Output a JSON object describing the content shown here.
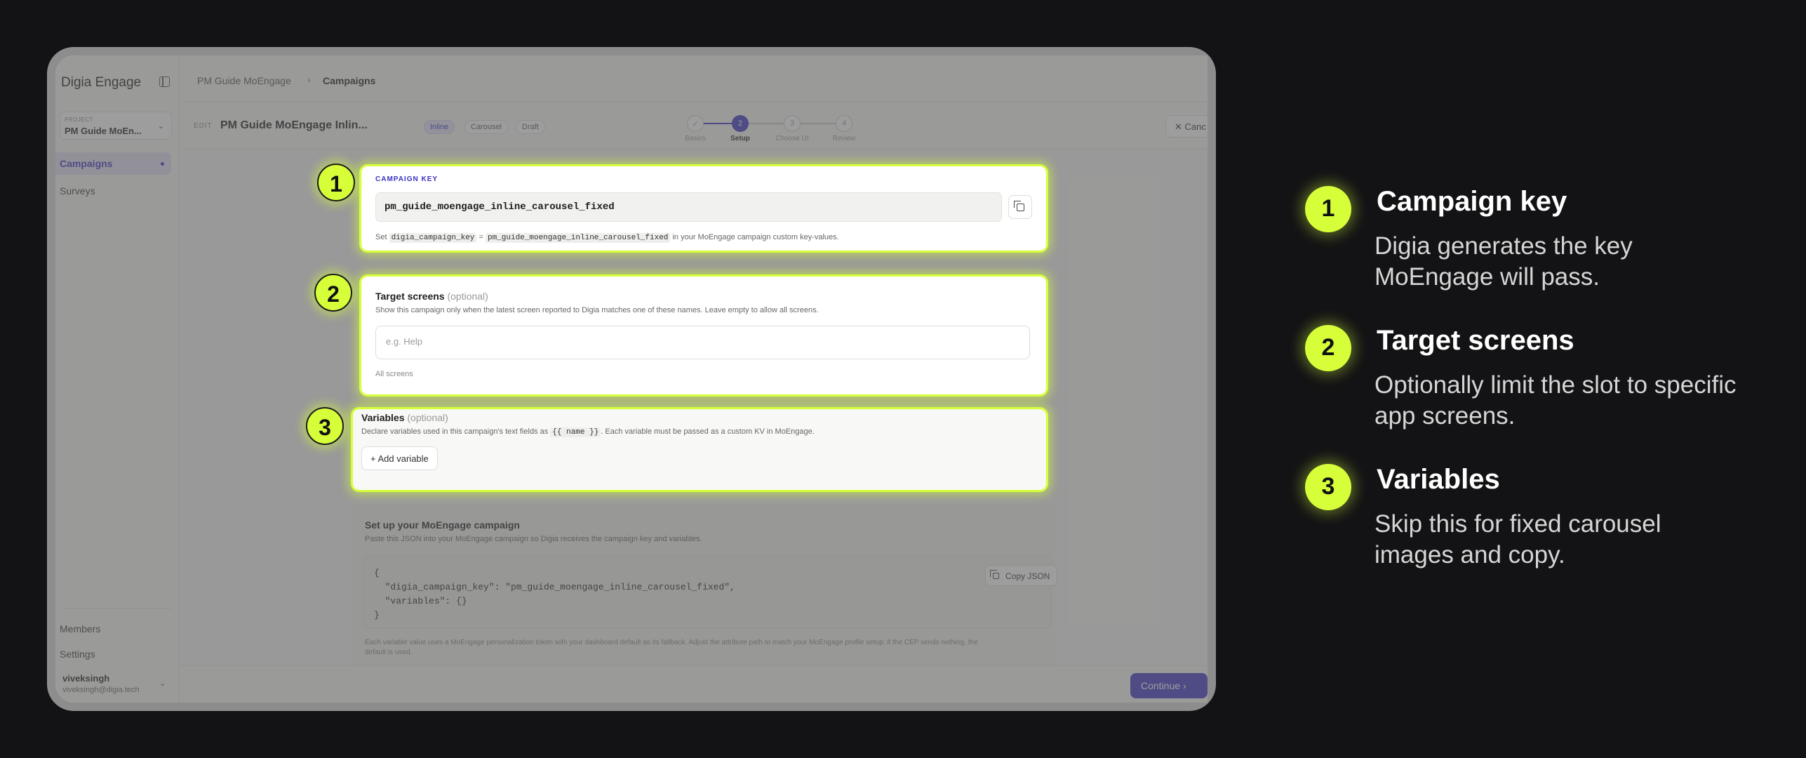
{
  "app": {
    "brand": "Digia Engage",
    "project_label": "PROJECT",
    "project_name": "PM Guide MoEn...",
    "nav": {
      "campaigns": "Campaigns",
      "surveys": "Surveys",
      "members": "Members",
      "settings": "Settings"
    },
    "user": {
      "name": "viveksingh",
      "email": "viveksingh@digia.tech"
    }
  },
  "breadcrumb": {
    "root": "PM Guide MoEngage",
    "separator": "›",
    "current": "Campaigns"
  },
  "edit_header": {
    "edit_tag": "EDIT",
    "title": "PM Guide MoEngage Inlin...",
    "pills": [
      "Inline",
      "Carousel",
      "Draft"
    ],
    "steps": [
      {
        "number": "✓",
        "label": "Basics"
      },
      {
        "number": "2",
        "label": "Setup"
      },
      {
        "number": "3",
        "label": "Choose UI"
      },
      {
        "number": "4",
        "label": "Review"
      }
    ],
    "cancel_label": "Canc"
  },
  "campaign_key": {
    "label": "CAMPAIGN KEY",
    "value": "pm_guide_moengage_inline_carousel_fixed",
    "hint_prefix": "Set",
    "hint_key": "digia_campaign_key",
    "hint_eq": "=",
    "hint_value": "pm_guide_moengage_inline_carousel_fixed",
    "hint_suffix": "in your MoEngage campaign custom key-values."
  },
  "target_screens": {
    "title": "Target screens",
    "optional": "(optional)",
    "description": "Show this campaign only when the latest screen reported to Digia matches one of these names. Leave empty to allow all screens.",
    "placeholder": "e.g. Help",
    "note": "All screens"
  },
  "variables": {
    "title": "Variables",
    "optional": "(optional)",
    "description_prefix": "Declare variables used in this campaign's text fields as",
    "description_code": "{{ name }}",
    "description_suffix": ". Each variable must be passed as a custom KV in MoEngage.",
    "add_button": "Add variable"
  },
  "moengage_setup": {
    "title": "Set up your MoEngage campaign",
    "description": "Paste this JSON into your MoEngage campaign so Digia receives the campaign key and variables.",
    "code": "{\n  \"digia_campaign_key\": \"pm_guide_moengage_inline_carousel_fixed\",\n  \"variables\": {}\n}",
    "copy_button": "Copy JSON",
    "footnote_line1": "Each variable value uses a MoEngage personalization token with your dashboard default as its fallback. Adjust the attribute path to match your MoEngage profile setup; if the CEP sends nothing, the",
    "footnote_line2": "default is used."
  },
  "footer": {
    "continue_label": "Continue"
  },
  "explanations": [
    {
      "number": "1",
      "title": "Campaign key",
      "body": "Digia generates the key MoEngage will pass."
    },
    {
      "number": "2",
      "title": "Target screens",
      "body": "Optionally limit the slot to specific app screens."
    },
    {
      "number": "3",
      "title": "Variables",
      "body": "Skip this for fixed carousel images and copy."
    }
  ],
  "colors": {
    "accent": "#3b32c3",
    "highlight": "#d6ff3a",
    "background": "#131315"
  }
}
